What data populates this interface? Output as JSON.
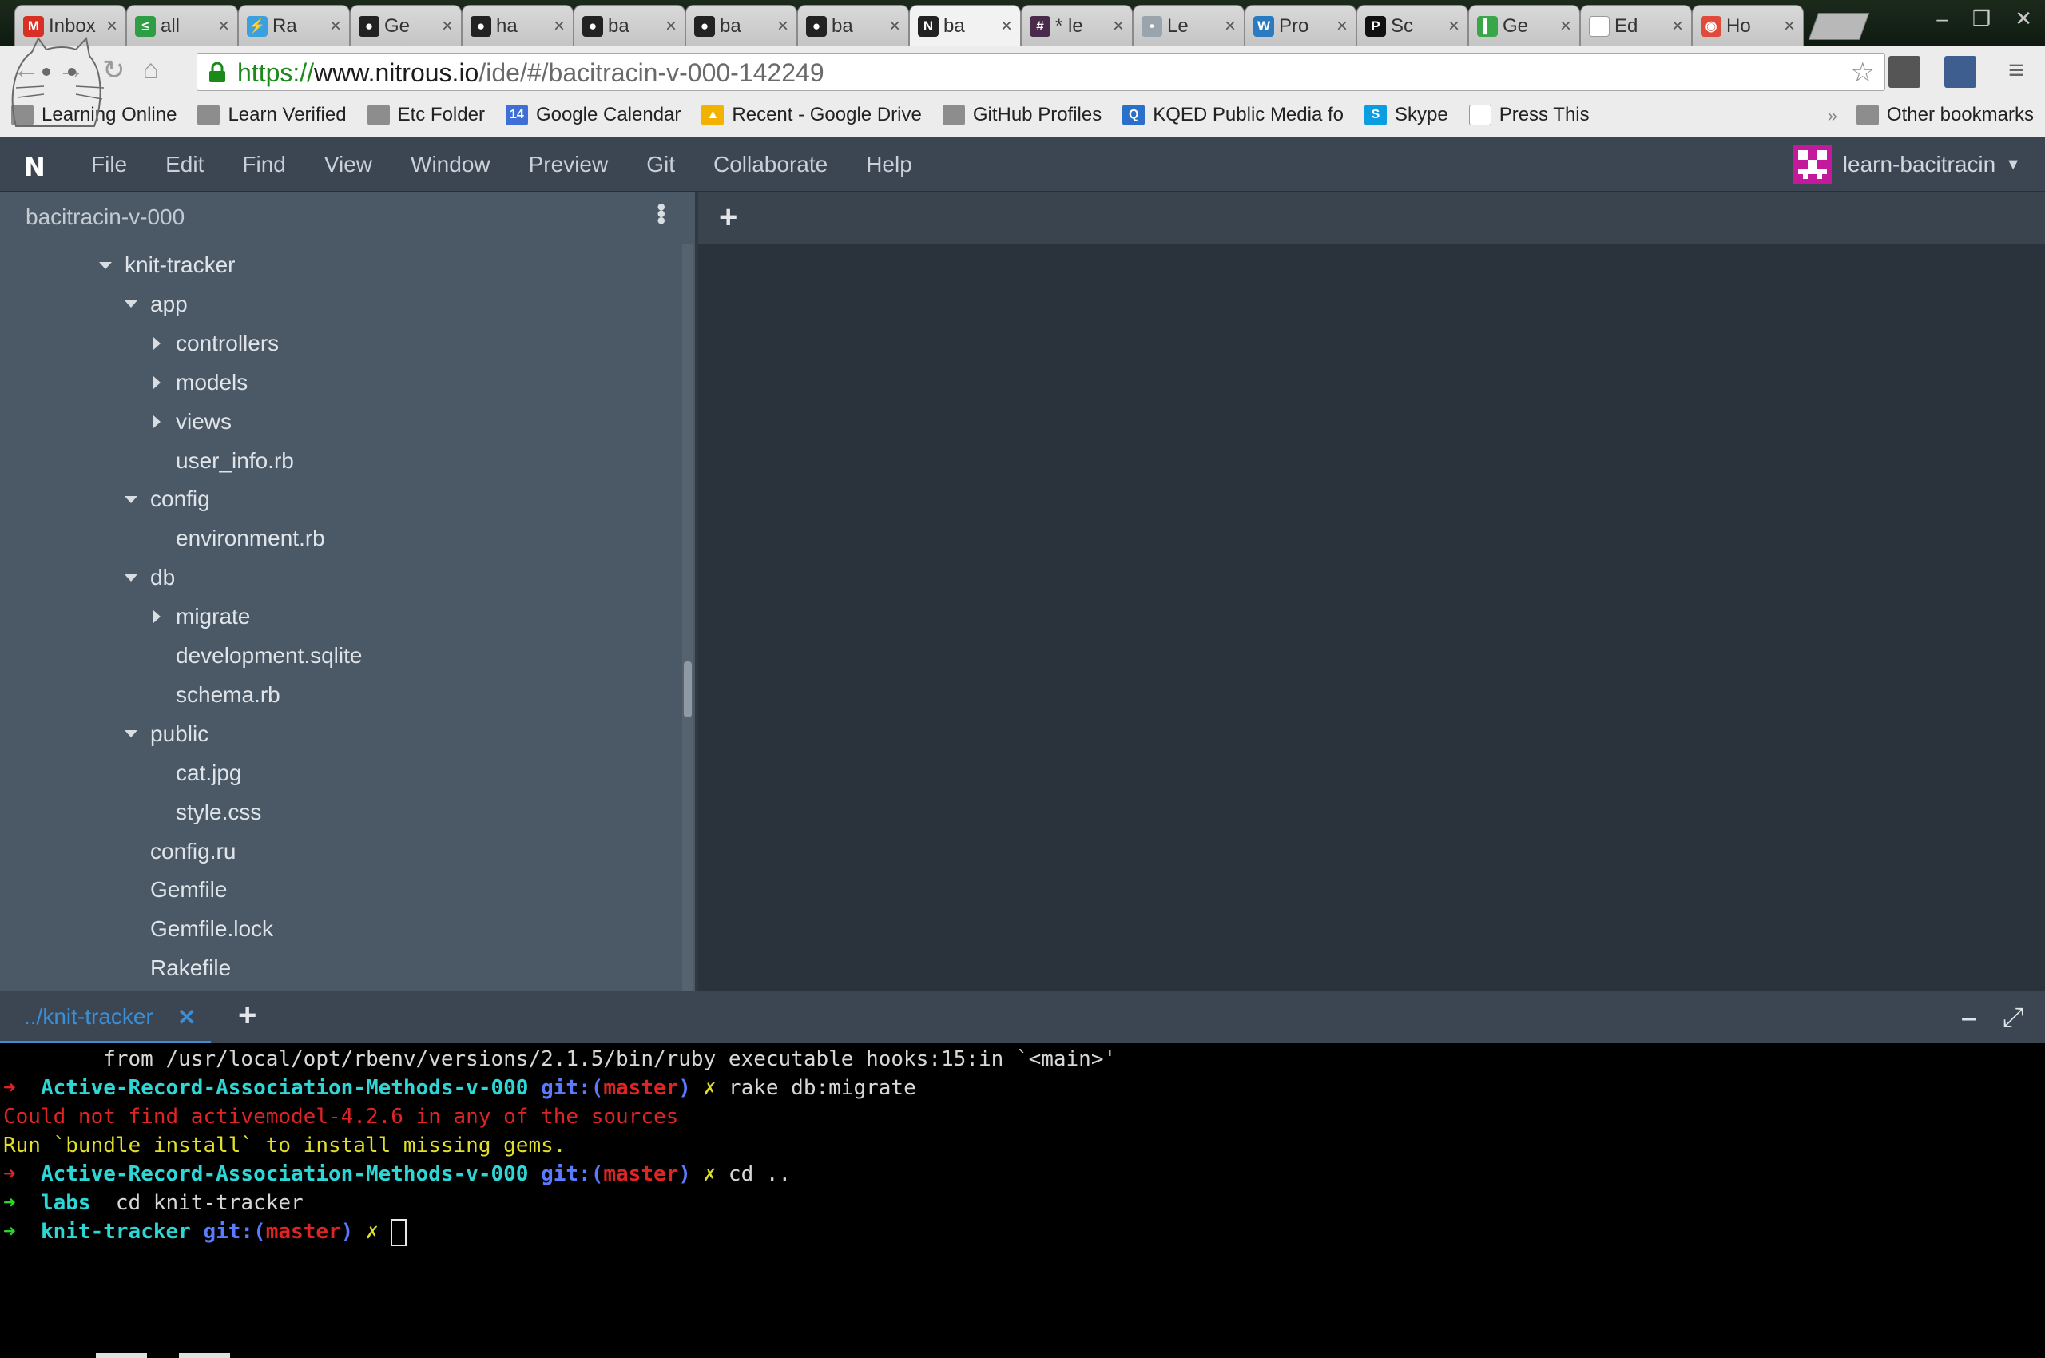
{
  "browser": {
    "tabs": [
      {
        "title": "Inbox",
        "icon": "gmail-icon",
        "fav_text": "M",
        "color": "#d93025",
        "active": false
      },
      {
        "title": "all",
        "icon": "green-app-icon",
        "fav_text": "≤",
        "color": "#2e9e44",
        "active": false
      },
      {
        "title": "Ra",
        "icon": "lightning-icon",
        "fav_text": "⚡",
        "color": "#3aa0e0",
        "active": false
      },
      {
        "title": "Ge",
        "icon": "github-icon",
        "fav_text": "●",
        "color": "#222222",
        "active": false
      },
      {
        "title": "ha",
        "icon": "github-icon",
        "fav_text": "●",
        "color": "#222222",
        "active": false
      },
      {
        "title": "ba",
        "icon": "github-icon",
        "fav_text": "●",
        "color": "#222222",
        "active": false
      },
      {
        "title": "ba",
        "icon": "github-icon",
        "fav_text": "●",
        "color": "#222222",
        "active": false
      },
      {
        "title": "ba",
        "icon": "github-icon",
        "fav_text": "●",
        "color": "#222222",
        "active": false
      },
      {
        "title": "ba",
        "icon": "nitrous-icon",
        "fav_text": "N",
        "color": "#222222",
        "active": true
      },
      {
        "title": "* le",
        "icon": "slack-hash-icon",
        "fav_text": "#",
        "color": "#4a2a4a",
        "active": false
      },
      {
        "title": "Le",
        "icon": "person-icon",
        "fav_text": "•",
        "color": "#9aa4ad",
        "active": false
      },
      {
        "title": "Pro",
        "icon": "wordpress-icon",
        "fav_text": "W",
        "color": "#2a7bbf",
        "active": false
      },
      {
        "title": "Sc",
        "icon": "press-p-icon",
        "fav_text": "P",
        "color": "#111111",
        "active": false
      },
      {
        "title": "Ge",
        "icon": "trello-icon",
        "fav_text": "▌",
        "color": "#3aa64a",
        "active": false
      },
      {
        "title": "Ed",
        "icon": "page-icon",
        "fav_text": "",
        "color": "#ffffff",
        "active": false
      },
      {
        "title": "Ho",
        "icon": "chrome-icon",
        "fav_text": "◉",
        "color": "#e04a3a",
        "active": false
      }
    ],
    "url": {
      "scheme": "https://",
      "domain": "www.nitrous.io",
      "path": "/ide/#/bacitracin-v-000-142249"
    },
    "bookmarks": [
      {
        "label": "Learning Online",
        "icon": "folder-icon"
      },
      {
        "label": "Learn Verified",
        "icon": "folder-icon"
      },
      {
        "label": "Etc Folder",
        "icon": "folder-icon"
      },
      {
        "label": "Google Calendar",
        "icon": "calendar-icon",
        "fav_text": "14",
        "color": "#3d6fd6"
      },
      {
        "label": "Recent - Google Drive",
        "icon": "drive-icon",
        "fav_text": "▲",
        "color": "#f2b300"
      },
      {
        "label": "GitHub Profiles",
        "icon": "folder-icon"
      },
      {
        "label": "KQED Public Media fo",
        "icon": "kqed-icon",
        "fav_text": "Q",
        "color": "#2a6fc9"
      },
      {
        "label": "Skype",
        "icon": "skype-icon",
        "fav_text": "S",
        "color": "#0a9de0"
      },
      {
        "label": "Press This",
        "icon": "page-icon",
        "fav_text": "",
        "color": "#ffffff"
      }
    ],
    "bookmarks_more": "»",
    "other_bookmarks": "Other bookmarks"
  },
  "ide": {
    "logo": "N",
    "menus": [
      "File",
      "Edit",
      "Find",
      "View",
      "Window",
      "Preview",
      "Git",
      "Collaborate",
      "Help"
    ],
    "user": "learn-bacitracin",
    "project": "bacitracin-v-000",
    "tree": [
      {
        "label": "knit-tracker",
        "depth": 0,
        "arrow": "down"
      },
      {
        "label": "app",
        "depth": 1,
        "arrow": "down"
      },
      {
        "label": "controllers",
        "depth": 2,
        "arrow": "right"
      },
      {
        "label": "models",
        "depth": 2,
        "arrow": "right"
      },
      {
        "label": "views",
        "depth": 2,
        "arrow": "right"
      },
      {
        "label": "user_info.rb",
        "depth": 2,
        "arrow": "none"
      },
      {
        "label": "config",
        "depth": 1,
        "arrow": "down"
      },
      {
        "label": "environment.rb",
        "depth": 2,
        "arrow": "none"
      },
      {
        "label": "db",
        "depth": 1,
        "arrow": "down"
      },
      {
        "label": "migrate",
        "depth": 2,
        "arrow": "right"
      },
      {
        "label": "development.sqlite",
        "depth": 2,
        "arrow": "none"
      },
      {
        "label": "schema.rb",
        "depth": 2,
        "arrow": "none"
      },
      {
        "label": "public",
        "depth": 1,
        "arrow": "down"
      },
      {
        "label": "cat.jpg",
        "depth": 2,
        "arrow": "none"
      },
      {
        "label": "style.css",
        "depth": 2,
        "arrow": "none"
      },
      {
        "label": "config.ru",
        "depth": 1,
        "arrow": "none"
      },
      {
        "label": "Gemfile",
        "depth": 1,
        "arrow": "none"
      },
      {
        "label": "Gemfile.lock",
        "depth": 1,
        "arrow": "none"
      },
      {
        "label": "Rakefile",
        "depth": 1,
        "arrow": "none"
      }
    ],
    "terminal_tab": "../knit-tracker",
    "terminal_lines": [
      [
        {
          "t": "        from /usr/local/opt/rbenv/versions/2.1.5/bin/ruby_executable_hooks:15:in `<main>'",
          "c": ""
        }
      ],
      [
        {
          "t": "➜  ",
          "c": "c-red"
        },
        {
          "t": "Active-Record-Association-Methods-v-000",
          "c": "c-cyan"
        },
        {
          "t": " git:(",
          "c": "c-blue"
        },
        {
          "t": "master",
          "c": "c-red"
        },
        {
          "t": ")",
          "c": "c-blue"
        },
        {
          "t": " ✗",
          "c": "c-yelb"
        },
        {
          "t": " rake db:migrate",
          "c": ""
        }
      ],
      [
        {
          "t": "Could not find activemodel-4.2.6 in any of the sources",
          "c": "c-redn"
        }
      ],
      [
        {
          "t": "Run `bundle install` to install missing gems.",
          "c": "c-yel"
        }
      ],
      [
        {
          "t": "➜  ",
          "c": "c-red"
        },
        {
          "t": "Active-Record-Association-Methods-v-000",
          "c": "c-cyan"
        },
        {
          "t": " git:(",
          "c": "c-blue"
        },
        {
          "t": "master",
          "c": "c-red"
        },
        {
          "t": ")",
          "c": "c-blue"
        },
        {
          "t": " ✗",
          "c": "c-yelb"
        },
        {
          "t": " cd ..",
          "c": ""
        }
      ],
      [
        {
          "t": "➜  ",
          "c": "c-green"
        },
        {
          "t": "labs",
          "c": "c-cyan"
        },
        {
          "t": "  cd knit-tracker",
          "c": ""
        }
      ],
      [
        {
          "t": "➜  ",
          "c": "c-green"
        },
        {
          "t": "knit-tracker",
          "c": "c-cyan"
        },
        {
          "t": " git:(",
          "c": "c-blue"
        },
        {
          "t": "master",
          "c": "c-red"
        },
        {
          "t": ")",
          "c": "c-blue"
        },
        {
          "t": " ✗ ",
          "c": "c-yelb"
        }
      ]
    ]
  }
}
